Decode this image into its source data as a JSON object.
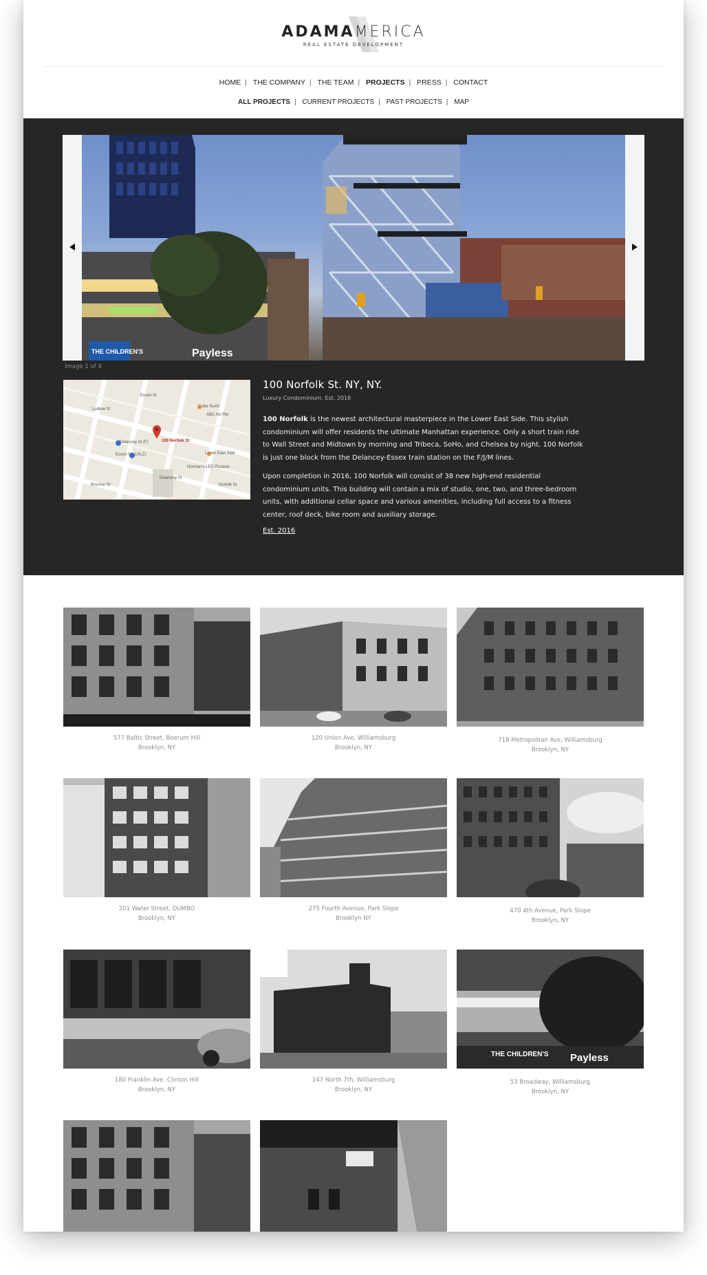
{
  "brand": {
    "logo_bold": "ADAMA",
    "logo_light": "MERICA",
    "tagline": "REAL ESTATE DEVELOPMENT"
  },
  "nav": [
    {
      "label": "HOME",
      "active": false
    },
    {
      "label": "THE COMPANY",
      "active": false
    },
    {
      "label": "THE TEAM",
      "active": false
    },
    {
      "label": "PROJECTS",
      "active": true
    },
    {
      "label": "PRESS",
      "active": false
    },
    {
      "label": "CONTACT",
      "active": false
    }
  ],
  "subnav": [
    {
      "label": "ALL PROJECTS",
      "active": true
    },
    {
      "label": "CURRENT PROJECTS",
      "active": false
    },
    {
      "label": "PAST PROJECTS",
      "active": false
    },
    {
      "label": "MAP",
      "active": false
    }
  ],
  "slider": {
    "caption": "Image 1 of 4",
    "prev_icon": "triangle-left-icon",
    "next_icon": "triangle-right-icon"
  },
  "map": {
    "pin_label": "100 Norfolk St",
    "labels": [
      "Delancey St (F)",
      "Essex St (J,M,Z)",
      "Cube Sushi",
      "ABC No Rio",
      "Lower East Side",
      "Norman's LES Pizzeria",
      "Delancey St",
      "Broome St",
      "Ludlow St",
      "Essex St",
      "Norfolk St"
    ]
  },
  "project": {
    "title": "100 Norfolk St. NY, NY.",
    "subtitle": "Luxury Condominium. Est. 2016",
    "para1_bold": "100 Norfolk",
    "para1": " is the newest architectural masterpiece in the Lower East Side. This stylish condominium will offer residents the ultimate Manhattan experience. Only a short train ride to Wall Street and Midtown by morning and Tribeca, SoHo, and Chelsea by night. 100 Norfolk is just one block from the Delancey-Essex train station on the F/J/M lines.",
    "para2": "Upon completion in 2016, 100 Norfolk will consist of 38 new high-end residential condominium units. This building will contain a mix of studio, one, two, and three-bedroom units, with additional cellar space and various amenities, including full access to a fitness center, roof deck, bike room and auxiliary storage.",
    "link": "Est. 2016"
  },
  "projects": [
    {
      "line1": "577 Baltic Street, Boerum Hill",
      "line2": "Brooklyn, NY"
    },
    {
      "line1": "120 Union Ave, Williamsburg",
      "line2": "Brooklyn, NY"
    },
    {
      "line1": "718 Metropolitan Ave, Williamsburg",
      "line2": "Brooklyn, NY"
    },
    {
      "line1": "201 Water Street, DUMBO",
      "line2": "Brooklyn, NY"
    },
    {
      "line1": "275 Fourth Avenue, Park Slope",
      "line2": "Brooklyn NY"
    },
    {
      "line1": "470 4th Avenue, Park Slope",
      "line2": "Brooklyn, NY"
    },
    {
      "line1": "180 Franklin Ave. Clinton Hill",
      "line2": "Brooklyn, NY"
    },
    {
      "line1": "247 North 7th, Williamsburg",
      "line2": "Brooklyn, NY"
    },
    {
      "line1": "53 Broadway, Williamsburg",
      "line2": "Brooklyn, NY"
    },
    {
      "line1": "",
      "line2": ""
    },
    {
      "line1": "",
      "line2": ""
    }
  ]
}
